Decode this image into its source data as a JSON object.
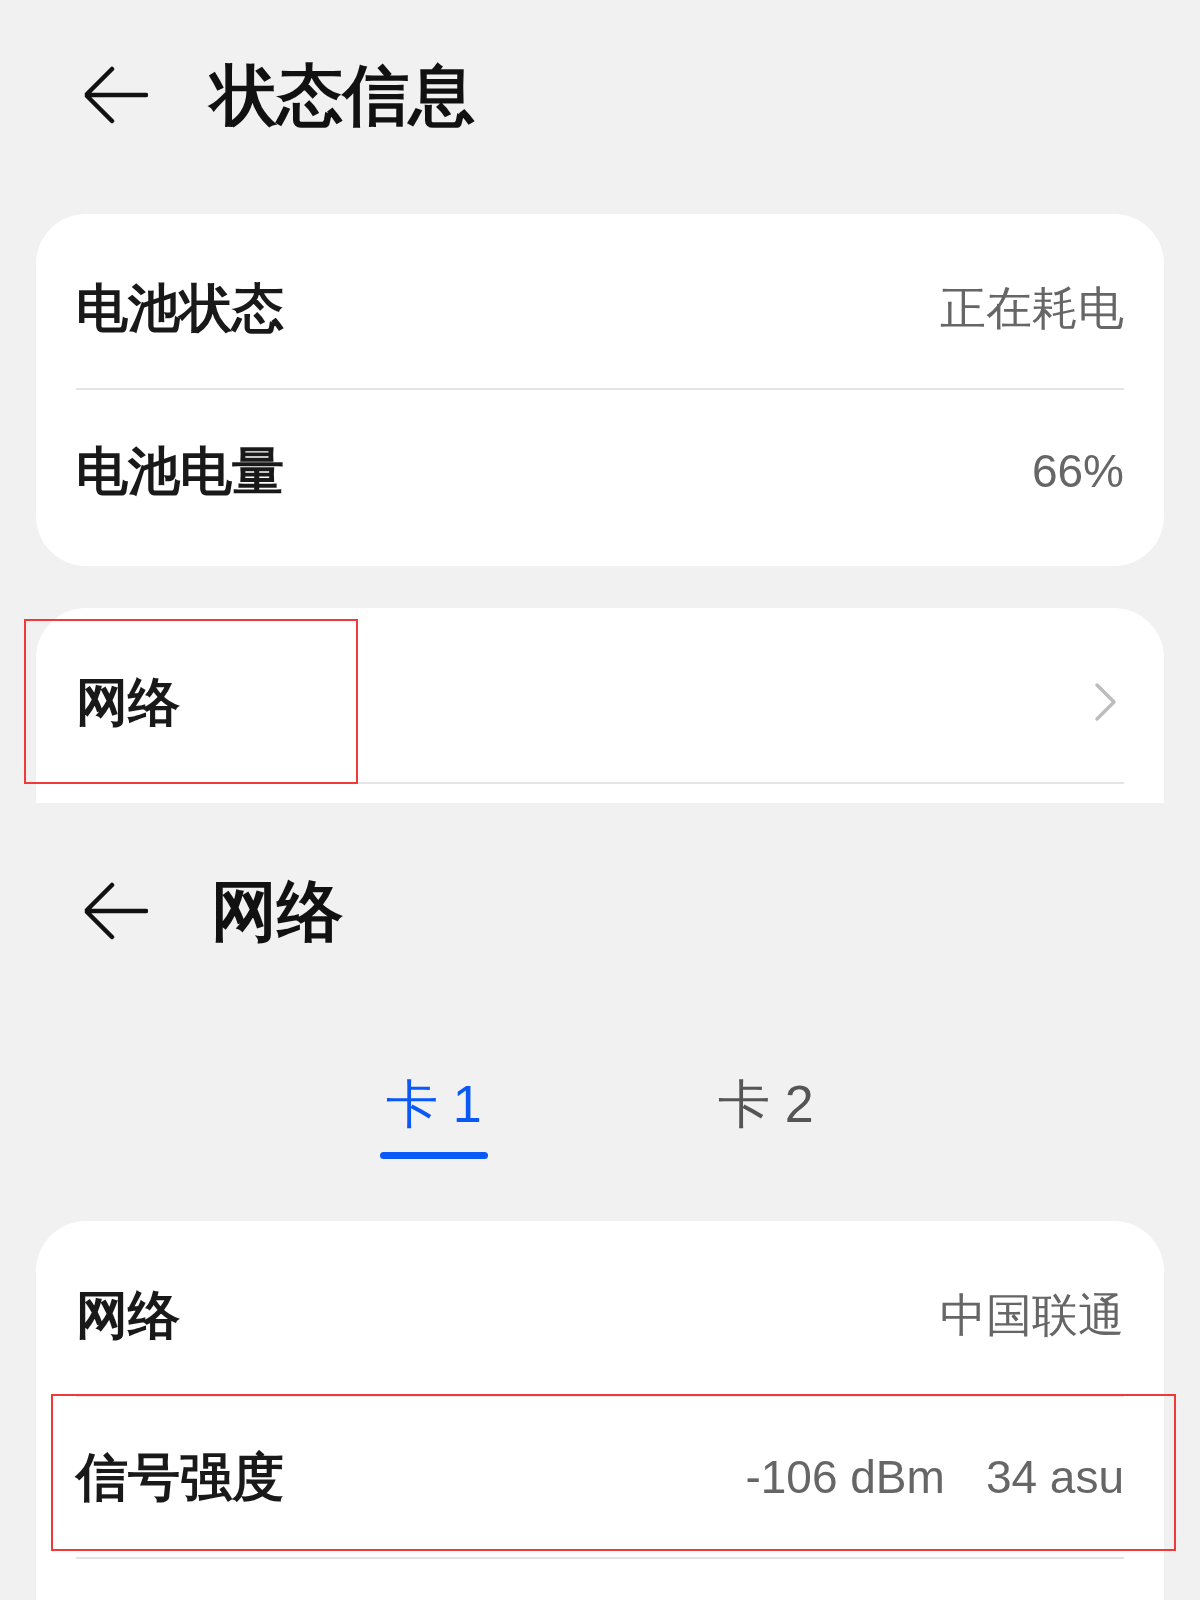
{
  "screens": [
    {
      "header": {
        "title": "状态信息"
      },
      "cards": [
        {
          "clipped": false,
          "rows": [
            {
              "kind": "value",
              "label": "电池状态",
              "values": [
                "正在耗电"
              ],
              "highlighted": false
            },
            {
              "kind": "value",
              "label": "电池电量",
              "values": [
                "66%"
              ],
              "highlighted": false
            }
          ]
        },
        {
          "clipped": true,
          "rows": [
            {
              "kind": "link",
              "label": "网络",
              "highlighted": true
            }
          ]
        }
      ]
    },
    {
      "header": {
        "title": "网络"
      },
      "tabs": [
        {
          "label": "卡 1",
          "selected": true
        },
        {
          "label": "卡 2",
          "selected": false
        }
      ],
      "cards": [
        {
          "clipped": true,
          "rows": [
            {
              "kind": "value",
              "label": "网络",
              "values": [
                "中国联通"
              ],
              "highlighted": false
            },
            {
              "kind": "value",
              "label": "信号强度",
              "values": [
                "-106 dBm",
                "34 asu"
              ],
              "highlighted": true
            }
          ]
        }
      ]
    }
  ]
}
